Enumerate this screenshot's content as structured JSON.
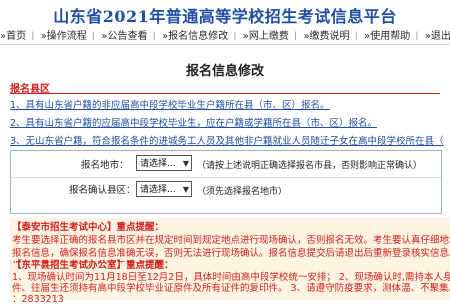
{
  "header": {
    "site_title": "山东省2021年普通高等学校招生考试信息平台",
    "nav": [
      "»首页",
      "»操作流程",
      "»公告查看",
      "»报名信息修改",
      "»网上缴费",
      "»缴费说明",
      "»使用帮助",
      "»退出"
    ]
  },
  "page_title": "报名信息修改",
  "section_label": "报名县区",
  "requirements": [
    "1、具有山东省户籍的非应届高中段学校毕业生户籍所在县（市、区）报名。",
    "2、具有山东省户籍的应届高中段学校毕业生，应在户籍或学籍所在县（市、区）报名。",
    "3、无山东省户籍，符合报名条件的进城务工人员及其他非户籍就业人员随迁子女在高中段学校所在县（"
  ],
  "form": {
    "region_label": "报名地市：",
    "region_select": "请选择...",
    "region_hint": "（请按上述说明正确选择报名市县，否则影响正常确认）",
    "district_label": "报名确认县区：",
    "district_select": "请选择...",
    "district_hint": "（须先选择报名地市）"
  },
  "notice": {
    "city_office": "【泰安市招生考试中心】重点提醒：",
    "city_lines": [
      "考生要选择正确的报名县市区并在规定时间到规定地点进行现场确认，否则报名无效。考生要认真仔细地填",
      "报名信息，确保报名信息准确无误，否则无法进行现场确认。报名信息提交后请退出后重新登录核实信息。",
      "报名号要妥善保管，防止丢失或泄露。"
    ],
    "county_office": "【东平县招生考试办公室】重点提醒：",
    "county_lines": [
      "1、现场确认时间为11月18日至12月2日，具体时间由高中段学校统一安排；  2、现场确认时,需持本人身份证",
      "件、往届生还须持有高中段学校毕业证原件及所有证件的复印件。 3、请遵守防疫要求，测体温、不聚集。4",
      "：2833213"
    ]
  }
}
